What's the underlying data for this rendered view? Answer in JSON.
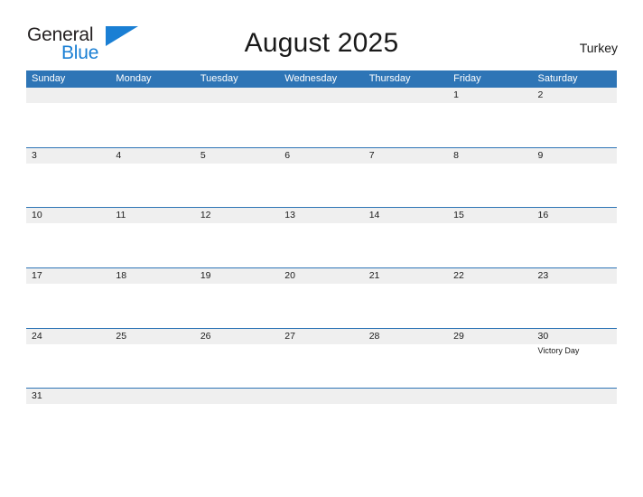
{
  "brand": {
    "word_general": "General",
    "word_blue": "Blue",
    "flag_color": "#1a7fd4"
  },
  "header": {
    "title": "August 2025",
    "country": "Turkey"
  },
  "theme": {
    "header_blue": "#2e75b6",
    "band_gray": "#efefef",
    "rule_blue": "#2e75b6",
    "text_dark": "#1a1a1a",
    "text_white": "#ffffff"
  },
  "calendar": {
    "weekdays": [
      "Sunday",
      "Monday",
      "Tuesday",
      "Wednesday",
      "Thursday",
      "Friday",
      "Saturday"
    ],
    "weeks": [
      [
        {
          "date": "",
          "event": ""
        },
        {
          "date": "",
          "event": ""
        },
        {
          "date": "",
          "event": ""
        },
        {
          "date": "",
          "event": ""
        },
        {
          "date": "",
          "event": ""
        },
        {
          "date": "1",
          "event": ""
        },
        {
          "date": "2",
          "event": ""
        }
      ],
      [
        {
          "date": "3",
          "event": ""
        },
        {
          "date": "4",
          "event": ""
        },
        {
          "date": "5",
          "event": ""
        },
        {
          "date": "6",
          "event": ""
        },
        {
          "date": "7",
          "event": ""
        },
        {
          "date": "8",
          "event": ""
        },
        {
          "date": "9",
          "event": ""
        }
      ],
      [
        {
          "date": "10",
          "event": ""
        },
        {
          "date": "11",
          "event": ""
        },
        {
          "date": "12",
          "event": ""
        },
        {
          "date": "13",
          "event": ""
        },
        {
          "date": "14",
          "event": ""
        },
        {
          "date": "15",
          "event": ""
        },
        {
          "date": "16",
          "event": ""
        }
      ],
      [
        {
          "date": "17",
          "event": ""
        },
        {
          "date": "18",
          "event": ""
        },
        {
          "date": "19",
          "event": ""
        },
        {
          "date": "20",
          "event": ""
        },
        {
          "date": "21",
          "event": ""
        },
        {
          "date": "22",
          "event": ""
        },
        {
          "date": "23",
          "event": ""
        }
      ],
      [
        {
          "date": "24",
          "event": ""
        },
        {
          "date": "25",
          "event": ""
        },
        {
          "date": "26",
          "event": ""
        },
        {
          "date": "27",
          "event": ""
        },
        {
          "date": "28",
          "event": ""
        },
        {
          "date": "29",
          "event": ""
        },
        {
          "date": "30",
          "event": "Victory Day"
        }
      ],
      [
        {
          "date": "31",
          "event": ""
        },
        {
          "date": "",
          "event": ""
        },
        {
          "date": "",
          "event": ""
        },
        {
          "date": "",
          "event": ""
        },
        {
          "date": "",
          "event": ""
        },
        {
          "date": "",
          "event": ""
        },
        {
          "date": "",
          "event": ""
        }
      ]
    ]
  }
}
